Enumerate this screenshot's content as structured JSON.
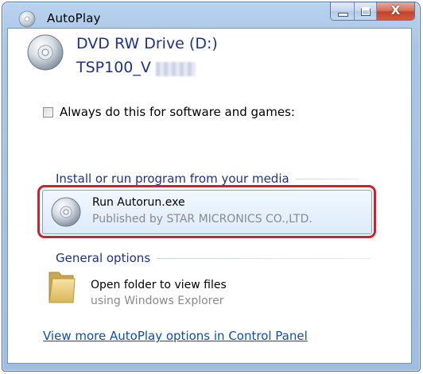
{
  "window": {
    "title": "AutoPlay",
    "caption_buttons": {
      "minimize": "minimize",
      "maximize": "maximize",
      "close": "X"
    }
  },
  "device": {
    "drive_name": "DVD RW Drive (D:)",
    "media_name": "TSP100_V"
  },
  "always_do": {
    "label": "Always do this for software and games:",
    "checked": false
  },
  "install_section": {
    "header": "Install or run program from your media",
    "option": {
      "title": "Run Autorun.exe",
      "publisher": "Published by STAR MICRONICS CO.,LTD."
    }
  },
  "general_section": {
    "header": "General options",
    "option": {
      "title": "Open folder to view files",
      "subtitle": "using Windows Explorer"
    }
  },
  "footer_link": "View more AutoPlay options in Control Panel",
  "colors": {
    "heading_blue": "#1e3287",
    "link_blue": "#0a4fb0",
    "highlight_red": "#d41f2a",
    "subtext_gray": "#8a8a8a"
  },
  "icons": {
    "title": "disc-icon",
    "drive": "disc-icon",
    "option": "disc-icon",
    "folder": "folder-icon"
  }
}
